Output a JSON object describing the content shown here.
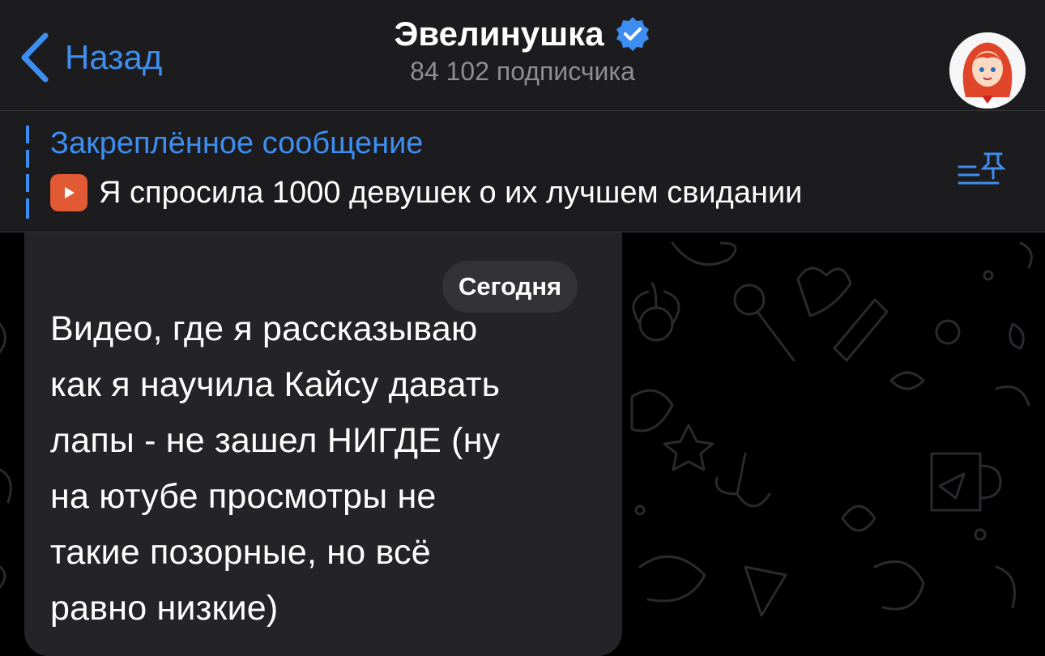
{
  "header": {
    "back_label": "Назад",
    "title": "Эвелинушка",
    "subtitle": "84 102 подписчика",
    "verified_icon": "verified-badge-icon",
    "accent_color": "#3d8ef0"
  },
  "pinned": {
    "title": "Закреплённое сообщение",
    "text": "Я спросила 1000 девушек о их лучшем свидании",
    "emoji_icon": "youtube-emoji-icon",
    "list_icon": "pinned-list-icon"
  },
  "chat": {
    "date_label": "Сегодня",
    "message_lines": [
      "Видео, где я рассказываю",
      "как я научила Кайсу давать",
      "лапы - не зашел НИГДЕ (ну",
      "на ютубе просмотры не",
      "такие позорные, но всё",
      "равно низкие)"
    ]
  }
}
